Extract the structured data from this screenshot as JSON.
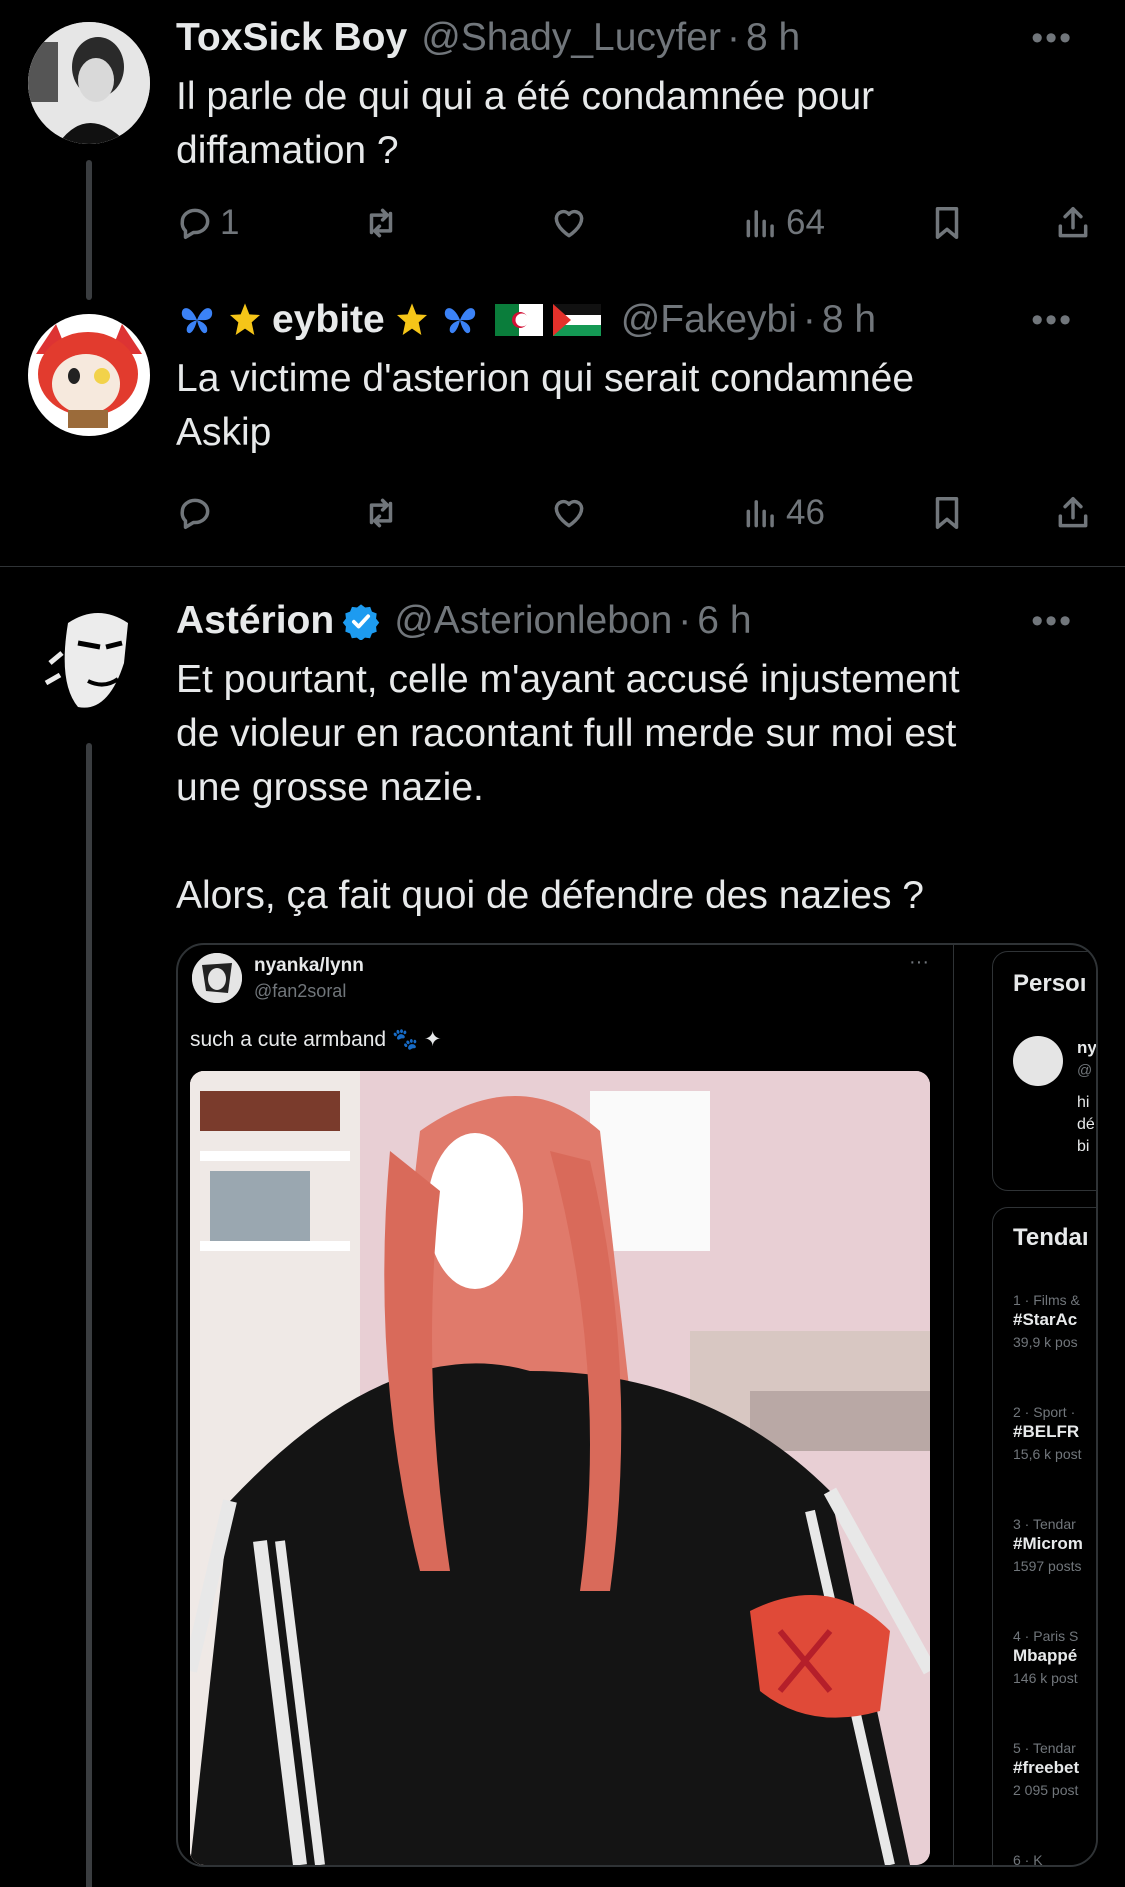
{
  "tweets": [
    {
      "name": "ToxSick Boy",
      "handle": "@Shady_Lucyfer",
      "sep": "·",
      "time": "8 h",
      "text": "Il parle de qui qui a été condamnée pour\ndiffamation ?",
      "replies": "1",
      "retweets": "",
      "likes": "",
      "views": "64"
    },
    {
      "name": "eybite",
      "handle": "@Fakeybi",
      "sep": "·",
      "time": "8 h",
      "text": "La victime d'asterion qui serait condamnée\nAskip",
      "replies": "",
      "retweets": "",
      "likes": "",
      "views": "46"
    },
    {
      "name": "Astérion",
      "handle": "@Asterionlebon",
      "sep": "·",
      "time": "6 h",
      "text": "Et pourtant, celle m'ayant accusé injustement\nde violeur en racontant full merde sur moi est\nune grosse nazie.\n\nAlors, ça fait quoi de défendre des nazies ?"
    }
  ],
  "more_label": "•••",
  "embed": {
    "name": "nyanka/lynn",
    "handle": "@fan2soral",
    "more": "···",
    "text": "such a cute armband 🐾 ✦",
    "side_card_1": {
      "title": "Persoı",
      "name": "ny",
      "handle": "@",
      "bio": [
        "hi",
        "dé",
        "bi"
      ]
    },
    "side_card_2": {
      "title": "Tendaı",
      "trends": [
        {
          "meta": "1 · Films &",
          "tag": "#StarAc",
          "count": "39,9 k pos"
        },
        {
          "meta": "2 · Sport ·",
          "tag": "#BELFR",
          "count": "15,6 k post"
        },
        {
          "meta": "3 · Tendar",
          "tag": "#Microm",
          "count": "1597 posts"
        },
        {
          "meta": "4 · Paris S",
          "tag": "Mbappé",
          "count": "146 k post"
        },
        {
          "meta": "5 · Tendar",
          "tag": "#freebet",
          "count": "2 095 post"
        },
        {
          "meta": "6 · K",
          "tag": "",
          "count": ""
        }
      ]
    }
  },
  "colors": {
    "bg": "#000000",
    "text": "#e7e9ea",
    "muted": "#71767b",
    "verified": "#1d9bf0",
    "divider": "#2f3336"
  },
  "icons": [
    "reply-icon",
    "retweet-icon",
    "like-icon",
    "views-icon",
    "bookmark-icon",
    "share-icon",
    "verified-badge-icon"
  ]
}
